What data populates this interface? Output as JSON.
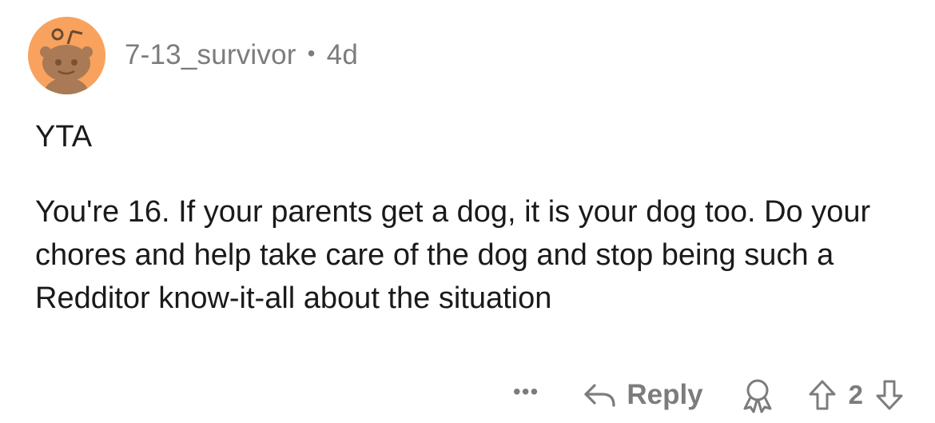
{
  "comment": {
    "username": "7-13_survivor",
    "separator": "•",
    "age": "4d",
    "verdict": "YTA",
    "text": "You're 16. If your parents get a dog, it is your dog too. Do your chores and help take care of the dog and stop being such a Redditor know-it-all about the situation"
  },
  "actions": {
    "more_label": "•••",
    "reply_label": "Reply",
    "vote_count": "2"
  },
  "icons": {
    "avatar": "snoo-avatar-icon",
    "reply": "reply-arrow-icon",
    "award": "award-icon",
    "upvote": "upvote-arrow-icon",
    "downvote": "downvote-arrow-icon"
  },
  "colors": {
    "avatar_bg": "#f8a25e",
    "meta_text": "#7c7c7c",
    "body_text": "#1a1a1b"
  }
}
